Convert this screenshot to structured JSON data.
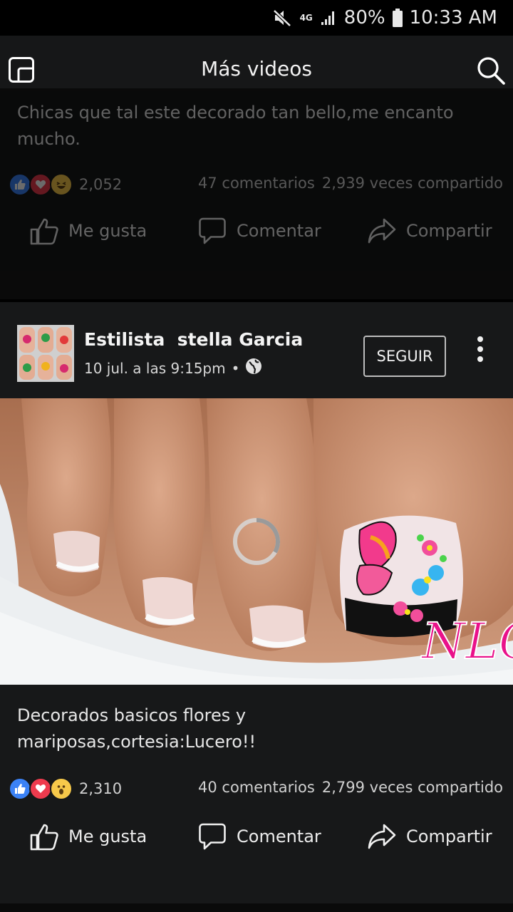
{
  "status_bar": {
    "network": "4G",
    "battery": "80%",
    "time": "10:33 AM"
  },
  "app_bar": {
    "title": "Más videos"
  },
  "post_previous": {
    "caption": "Chicas que tal este decorado tan bello,me encanto mucho.",
    "reaction_count": "2,052",
    "comments": "47 comentarios",
    "shares": "2,939 veces compartido"
  },
  "post": {
    "author": "Estilista  stella Garcia",
    "timestamp": "10 jul. a las 9:15pm",
    "separator": "•",
    "follow_label": "SEGUIR",
    "video_watermark": "NLC",
    "caption": "Decorados basicos flores y mariposas,cortesia:Lucero!!",
    "reaction_count": "2,310",
    "comments": "40 comentarios",
    "shares": "2,799 veces compartido"
  },
  "actions": {
    "like": "Me gusta",
    "comment": "Comentar",
    "share": "Compartir"
  },
  "icons": [
    "mute-icon",
    "signal-icon",
    "battery-icon",
    "pip-icon",
    "search-icon",
    "like-reaction-icon",
    "love-reaction-icon",
    "haha-reaction-icon",
    "wow-reaction-icon",
    "thumbs-up-icon",
    "comment-icon",
    "share-icon",
    "globe-icon",
    "more-icon",
    "loading-spinner-icon"
  ],
  "colors": {
    "background": "#000000",
    "card": "#171819",
    "like_blue": "#3b82f6",
    "love_red": "#ef3b4e",
    "emoji_yellow": "#f7c94a",
    "watermark_pink": "#e9118a"
  }
}
